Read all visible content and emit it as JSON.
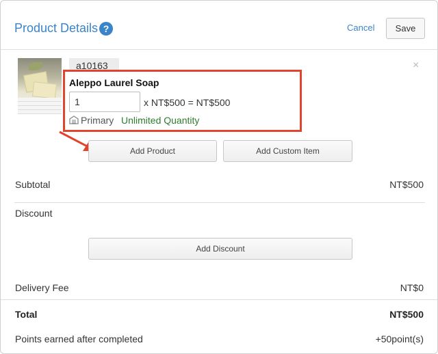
{
  "header": {
    "title": "Product Details",
    "help_icon": "?",
    "cancel_label": "Cancel",
    "save_label": "Save"
  },
  "item": {
    "sku": "a10163",
    "name": "Aleppo Laurel Soap",
    "quantity": "1",
    "price_line": "x NT$500 = NT$500",
    "warehouse": "Primary",
    "stock": "Unlimited Quantity",
    "remove_icon": "×"
  },
  "actions": {
    "add_product": "Add Product",
    "add_custom": "Add Custom Item",
    "add_discount": "Add Discount"
  },
  "summary": {
    "subtotal_label": "Subtotal",
    "subtotal_value": "NT$500",
    "discount_label": "Discount",
    "delivery_label": "Delivery Fee",
    "delivery_value": "NT$0",
    "total_label": "Total",
    "total_value": "NT$500",
    "points_label": "Points earned after completed",
    "points_value": "+50point(s)"
  },
  "colors": {
    "accent": "#3a84c9",
    "highlight": "#e0442c",
    "stock_green": "#2e7d2e"
  }
}
